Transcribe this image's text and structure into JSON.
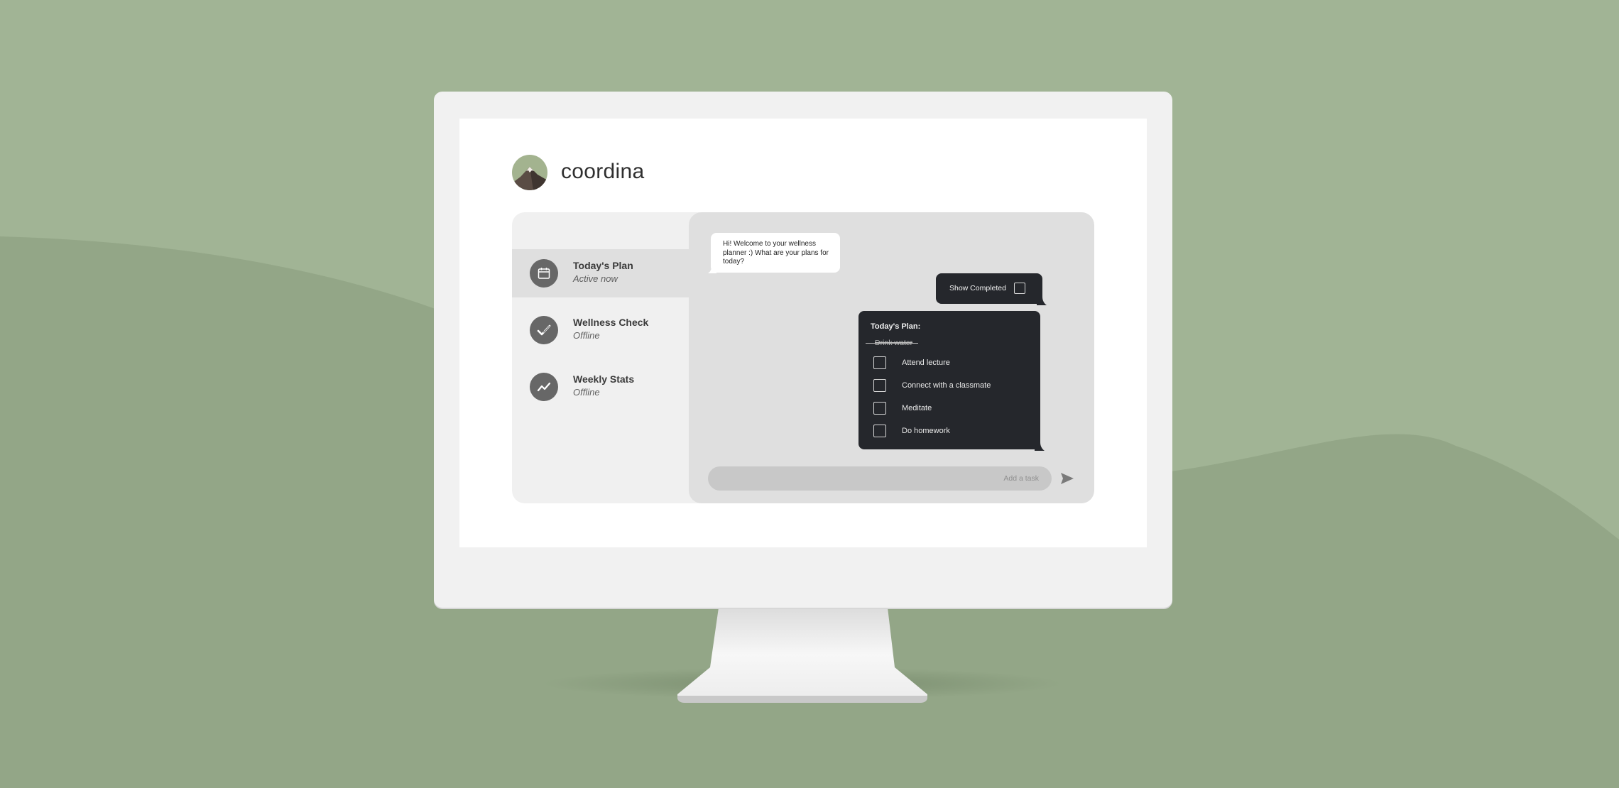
{
  "app": {
    "title": "coordina"
  },
  "sidebar": {
    "items": [
      {
        "label": "Today's Plan",
        "status": "Active now",
        "icon": "calendar-icon"
      },
      {
        "label": "Wellness Check",
        "status": "Offline",
        "icon": "check-icon"
      },
      {
        "label": "Weekly Stats",
        "status": "Offline",
        "icon": "trend-line-icon"
      }
    ]
  },
  "chat": {
    "welcome_message": "Hi! Welcome to your wellness planner :) What are your plans for today?",
    "show_completed_label": "Show Completed",
    "plan": {
      "title": "Today's Plan:",
      "completed_task": "Drink water",
      "tasks": [
        "Attend lecture",
        "Connect with a classmate",
        "Meditate",
        "Do homework"
      ]
    },
    "input_placeholder": "Add a task"
  },
  "colors": {
    "background": "#a1b495",
    "background_hill": "#93a687",
    "dark_bubble": "#25272c",
    "chat_area": "#dfdfdf",
    "sidebar": "#f0f0f0",
    "icon_circle": "#676767"
  }
}
